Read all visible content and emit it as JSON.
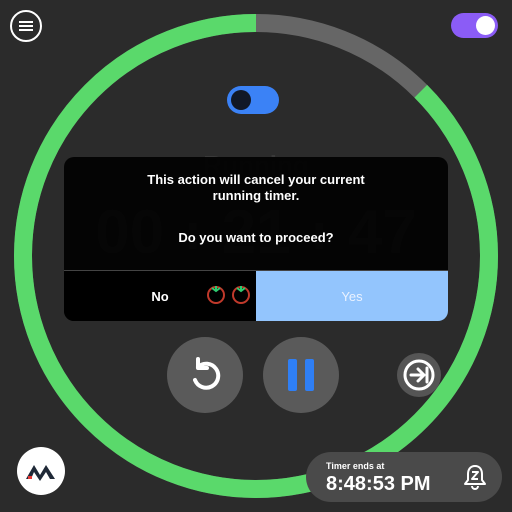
{
  "header": {
    "menu_icon": "hamburger-menu-icon",
    "top_toggle_on": true,
    "top_toggle_color": "#8b5cf6",
    "mode_toggle_on": true,
    "mode_toggle_color": "#3b82f6"
  },
  "progress": {
    "fraction_complete": 0.875,
    "ring_color": "#5ad96b",
    "track_color": "#666666"
  },
  "timer": {
    "status": "Running",
    "hours": "00",
    "minutes": "21",
    "seconds": "47",
    "separator": ":"
  },
  "dialog": {
    "message": "This action will cancel your current running timer.",
    "question": "Do you want to proceed?",
    "no_label": "No",
    "yes_label": "Yes",
    "yes_color": "#93c5fd",
    "session_icons": [
      "tomato-icon",
      "tomato-icon"
    ]
  },
  "controls": {
    "reset_icon": "undo-icon",
    "pause_icon": "pause-icon",
    "pause_color": "#2f7ff5",
    "skip_icon": "skip-next-icon"
  },
  "footer": {
    "logo_icon": "app-logo-icon",
    "timer_ends_label": "Timer ends at",
    "timer_ends_time": "8:48:53 PM",
    "snooze_icon": "snooze-bell-icon"
  }
}
